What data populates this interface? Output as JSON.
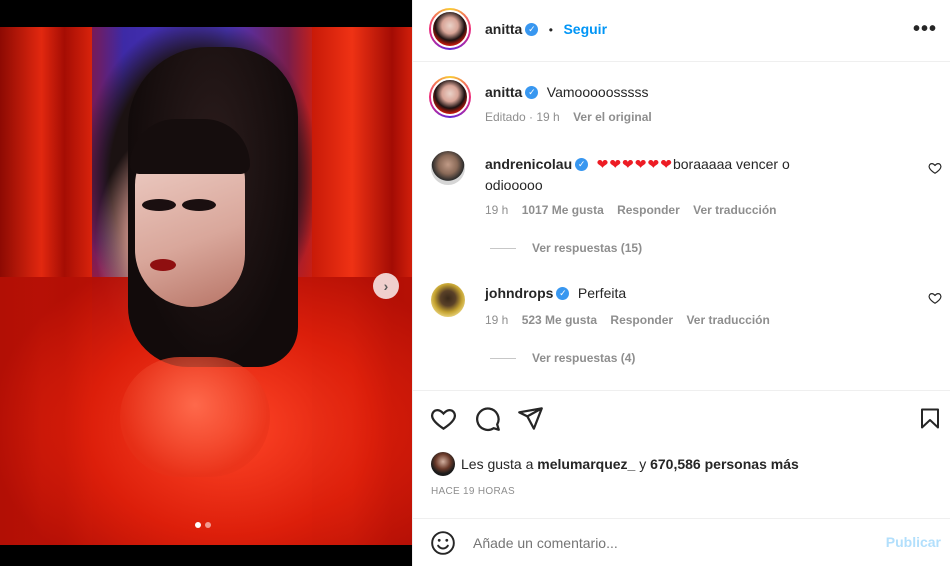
{
  "post": {
    "author": "anitta",
    "follow_label": "Seguir",
    "separator": "•",
    "more_label": "•••",
    "caption": "Vamooooosssss",
    "caption_meta_edited": "Editado · 19 h",
    "caption_meta_original": "Ver el original"
  },
  "media": {
    "next_label": "›",
    "carousel_count": 2,
    "carousel_active": 1
  },
  "comments": [
    {
      "user": "andrenicolau",
      "hearts": "❤❤❤❤❤❤",
      "text_line1": "boraaaaa vencer o",
      "text_line2": "odiooooo",
      "time": "19 h",
      "likes": "1017 Me gusta",
      "reply": "Responder",
      "translate": "Ver traducción",
      "replies": "Ver respuestas (15)"
    },
    {
      "user": "johndrops",
      "text": "Perfeita",
      "time": "19 h",
      "likes": "523 Me gusta",
      "reply": "Responder",
      "translate": "Ver traducción",
      "replies": "Ver respuestas (4)"
    }
  ],
  "likes_line": {
    "prefix": "Les gusta a",
    "user": "melumarquez_",
    "connector": "y",
    "count": "670,586 personas más"
  },
  "timestamp": "HACE 19 HORAS",
  "comment_input": {
    "placeholder": "Añade un comentario...",
    "publish_label": "Publicar"
  },
  "icons": [
    "heart-icon",
    "comment-icon",
    "share-icon",
    "bookmark-icon",
    "emoji-icon",
    "verified-icon",
    "more-icon"
  ],
  "colors": {
    "accent": "#0095f6",
    "verified": "#3897f0",
    "publish_disabled": "#b2dffc",
    "heart_red": "#ed1c24"
  }
}
